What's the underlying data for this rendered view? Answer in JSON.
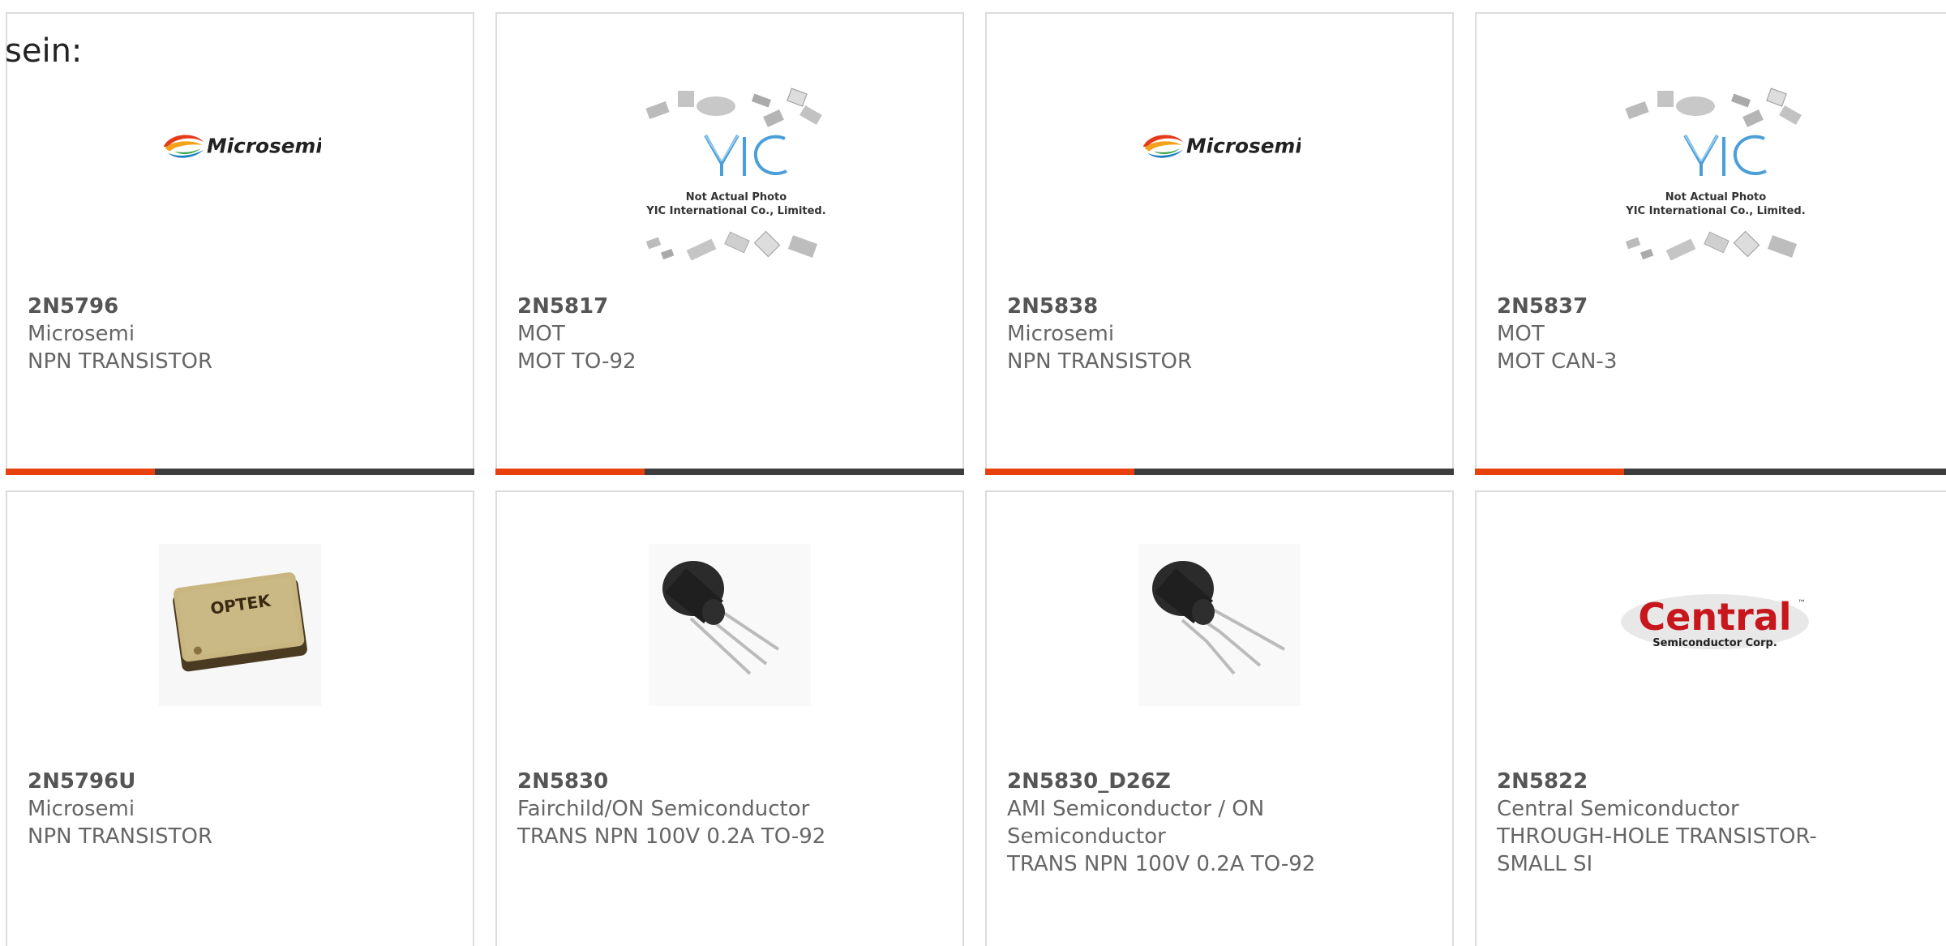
{
  "lead_text": "sein:",
  "colors": {
    "accent_orange": "#e8410e",
    "accent_dark": "#3d3d3d",
    "card_border": "#dcdcdc",
    "text_gray": "#666666"
  },
  "products": [
    {
      "part_no": "2N5796",
      "manufacturer": "Microsemi",
      "description": "NPN TRANSISTOR",
      "image": "microsemi-logo",
      "logo_text": "Microsemi"
    },
    {
      "part_no": "2N5817",
      "manufacturer": "MOT",
      "description": "MOT TO-92",
      "image": "yic-placeholder",
      "photo_note": "Not Actual Photo",
      "photo_company": "YIC International Co., Limited.",
      "logo_text": "YIC"
    },
    {
      "part_no": "2N5838",
      "manufacturer": "Microsemi",
      "description": "NPN TRANSISTOR",
      "image": "microsemi-logo",
      "logo_text": "Microsemi"
    },
    {
      "part_no": "2N5837",
      "manufacturer": "MOT",
      "description": "MOT CAN-3",
      "image": "yic-placeholder",
      "photo_note": "Not Actual Photo",
      "photo_company": "YIC International Co., Limited.",
      "logo_text": "YIC"
    },
    {
      "part_no": "2N5796U",
      "manufacturer": "Microsemi",
      "description": "NPN TRANSISTOR",
      "image": "optek-package",
      "logo_text": "OPTEK"
    },
    {
      "part_no": "2N5830",
      "manufacturer": "Fairchild/ON Semiconductor",
      "description": "TRANS NPN 100V 0.2A TO-92",
      "image": "to92-transistor"
    },
    {
      "part_no": "2N5830_D26Z",
      "manufacturer": "AMI Semiconductor / ON Semiconductor",
      "description": "TRANS NPN 100V 0.2A TO-92",
      "image": "to92-transistor-bent"
    },
    {
      "part_no": "2N5822",
      "manufacturer": "Central Semiconductor",
      "description": "THROUGH-HOLE TRANSISTOR-SMALL SI",
      "image": "central-logo",
      "logo_text": "Central",
      "logo_subtext": "Semiconductor Corp.",
      "logo_tm": "™"
    }
  ]
}
